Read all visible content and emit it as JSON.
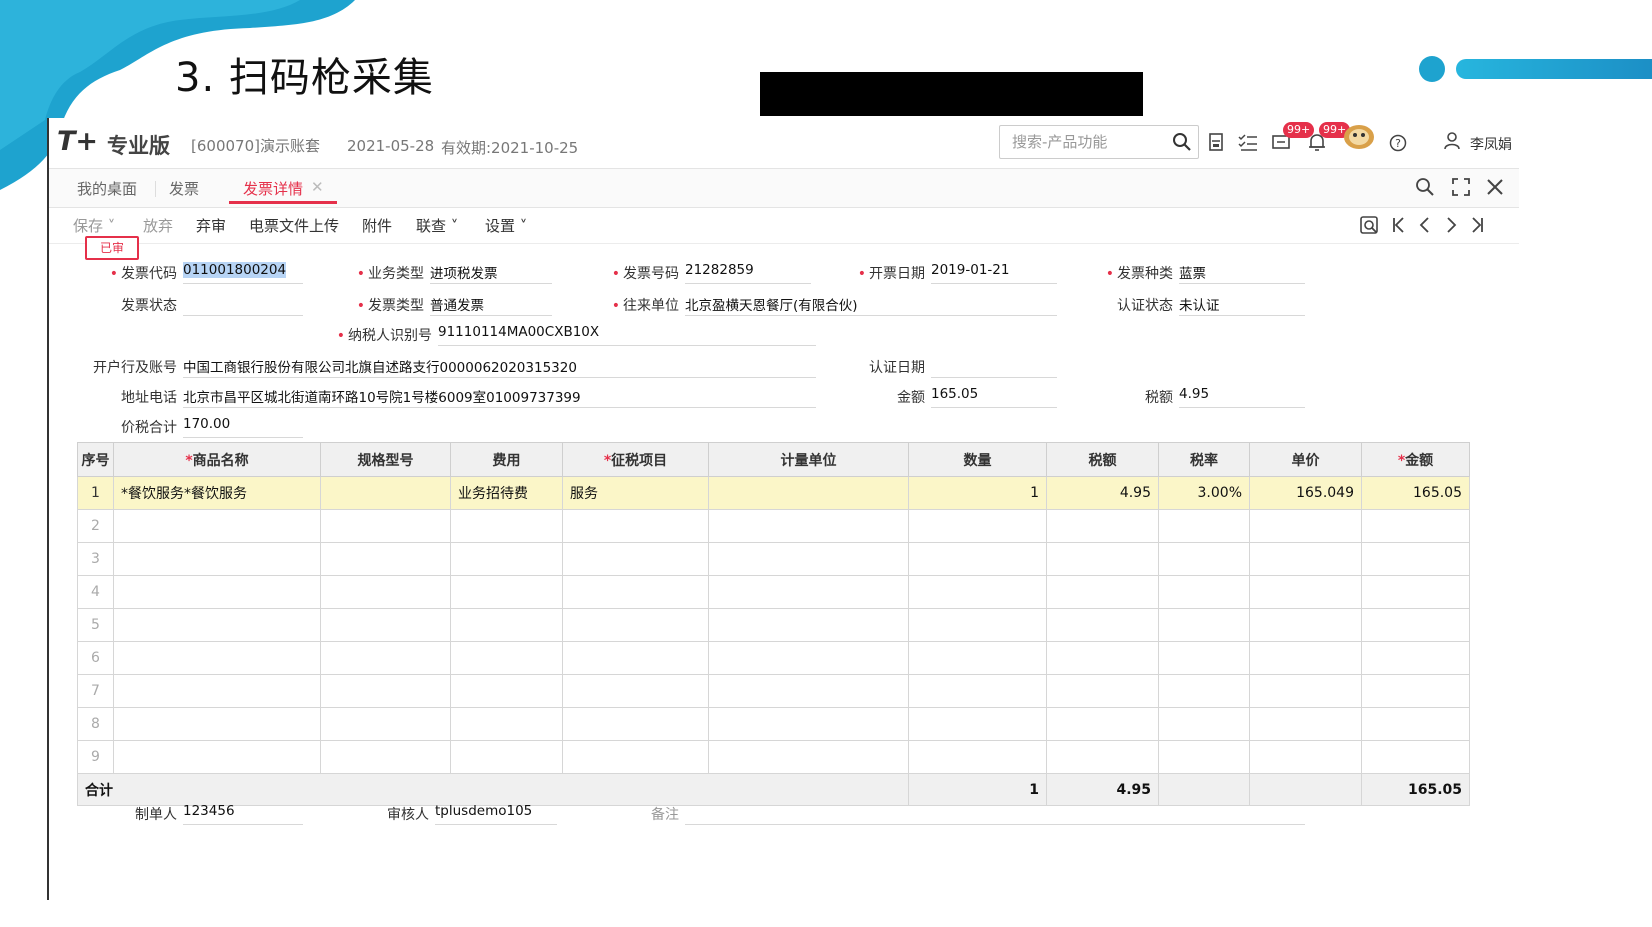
{
  "slide": {
    "title": "3. 扫码枪采集",
    "colors": {
      "accent": "#1ea3cf"
    }
  },
  "app": {
    "logo": "T+",
    "edition": "专业版",
    "account": "[600070]演示账套",
    "date": "2021-05-28",
    "validity": "有效期:2021-10-25",
    "search_placeholder": "搜索-产品功能",
    "badge_messages": "99+",
    "badge_alerts": "99+",
    "user_name": "李凤娟",
    "colors": {
      "brand_red": "#e5304a",
      "highlight_row": "#fbf6c8"
    }
  },
  "tabs": [
    {
      "label": "我的桌面"
    },
    {
      "label": "发票"
    },
    {
      "label": "发票详情",
      "active": true
    }
  ],
  "toolbar": {
    "save": "保存",
    "abandon": "放弃",
    "unaudit": "弃审",
    "upload": "电票文件上传",
    "attachment": "附件",
    "linked": "联查",
    "settings": "设置"
  },
  "stamp": "已审",
  "form": {
    "invoice_code": {
      "label": "发票代码",
      "value": "011001800204"
    },
    "business_type": {
      "label": "业务类型",
      "value": "进项税发票"
    },
    "invoice_number": {
      "label": "发票号码",
      "value": "21282859"
    },
    "issue_date": {
      "label": "开票日期",
      "value": "2019-01-21"
    },
    "invoice_kind": {
      "label": "发票种类",
      "value": "蓝票"
    },
    "invoice_status": {
      "label": "发票状态",
      "value": ""
    },
    "invoice_type": {
      "label": "发票类型",
      "value": "普通发票"
    },
    "counterparty": {
      "label": "往来单位",
      "value": "北京盈横天恩餐厅(有限合伙)"
    },
    "cert_status": {
      "label": "认证状态",
      "value": "未认证"
    },
    "taxpayer_id": {
      "label": "纳税人识别号",
      "value": "91110114MA00CXB10X"
    },
    "bank_account": {
      "label": "开户行及账号",
      "value": "中国工商银行股份有限公司北旗自述路支行0000062020315320"
    },
    "cert_date": {
      "label": "认证日期",
      "value": ""
    },
    "address_phone": {
      "label": "地址电话",
      "value": "北京市昌平区城北街道南环路10号院1号楼6009室01009737399"
    },
    "amount": {
      "label": "金额",
      "value": "165.05"
    },
    "tax_amount": {
      "label": "税额",
      "value": "4.95"
    },
    "total_with_tax": {
      "label": "价税合计",
      "value": "170.00"
    }
  },
  "grid": {
    "headers": [
      "序号",
      "商品名称",
      "规格型号",
      "费用",
      "征税项目",
      "计量单位",
      "数量",
      "税额",
      "税率",
      "单价",
      "金额"
    ],
    "required_marker": "*",
    "rows": [
      {
        "idx": "1",
        "name": "*餐饮服务*餐饮服务",
        "spec": "",
        "expense": "业务招待费",
        "tax_item": "服务",
        "unit": "",
        "qty": "1",
        "tax": "4.95",
        "rate": "3.00%",
        "price": "165.049",
        "amount": "165.05"
      },
      {
        "idx": "2"
      },
      {
        "idx": "3"
      },
      {
        "idx": "4"
      },
      {
        "idx": "5"
      },
      {
        "idx": "6"
      },
      {
        "idx": "7"
      },
      {
        "idx": "8"
      },
      {
        "idx": "9"
      }
    ],
    "total": {
      "label": "合计",
      "qty": "1",
      "tax": "4.95",
      "amount": "165.05"
    }
  },
  "footer": {
    "maker": {
      "label": "制单人",
      "value": "123456"
    },
    "auditor": {
      "label": "审核人",
      "value": "tplusdemo105"
    },
    "remark": {
      "label": "备注",
      "value": ""
    }
  }
}
